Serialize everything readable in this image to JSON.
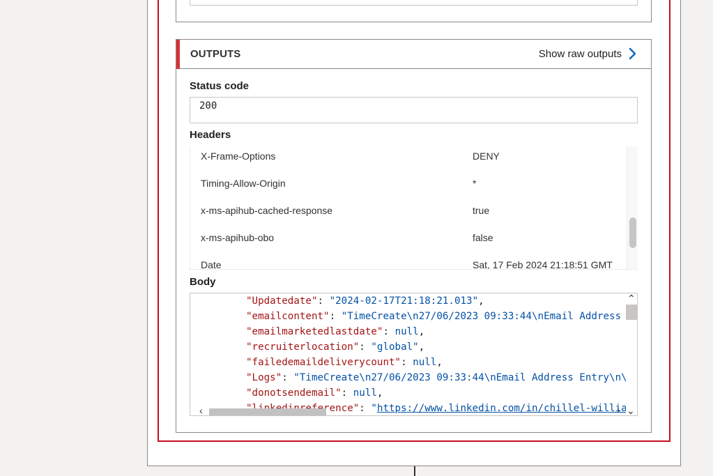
{
  "outputs": {
    "title": "OUTPUTS",
    "show_raw_label": "Show raw outputs",
    "accent_color": "#d13438",
    "chevron_icon": "chevron-right-icon"
  },
  "status": {
    "label": "Status code",
    "value": "200"
  },
  "headers": {
    "label": "Headers",
    "rows": [
      {
        "name": "X-Frame-Options",
        "value": "DENY"
      },
      {
        "name": "Timing-Allow-Origin",
        "value": "*"
      },
      {
        "name": "x-ms-apihub-cached-response",
        "value": "true"
      },
      {
        "name": "x-ms-apihub-obo",
        "value": "false"
      },
      {
        "name": "Date",
        "value": "Sat, 17 Feb 2024 21:18:51 GMT"
      }
    ]
  },
  "body": {
    "label": "Body",
    "lines": [
      {
        "key": "\"Updatedate\"",
        "sep": ": ",
        "val": "\"2024-02-17T21:18:21.013\"",
        "end": ",",
        "type": "s"
      },
      {
        "key": "\"emailcontent\"",
        "sep": ": ",
        "val": "\"TimeCreate\\n27/06/2023 09:33:44\\nEmail Address",
        "end": "",
        "type": "s"
      },
      {
        "key": "\"emailmarketedlastdate\"",
        "sep": ": ",
        "val": "null",
        "end": ",",
        "type": "n"
      },
      {
        "key": "\"recruiterlocation\"",
        "sep": ": ",
        "val": "\"global\"",
        "end": ",",
        "type": "s"
      },
      {
        "key": "\"failedemaildeliverycount\"",
        "sep": ": ",
        "val": "null",
        "end": ",",
        "type": "n"
      },
      {
        "key": "\"Logs\"",
        "sep": ": ",
        "val": "\"TimeCreate\\n27/06/2023 09:33:44\\nEmail Address Entry\\n\\",
        "end": "",
        "type": "s"
      },
      {
        "key": "\"donotsendemail\"",
        "sep": ": ",
        "val": "null",
        "end": ",",
        "type": "n"
      },
      {
        "key": "\"linkedinreference\"",
        "sep": ": ",
        "val": "\"",
        "url": "https://www.linkedin.com/in/chillel-willia",
        "end": "",
        "type": "s"
      }
    ]
  }
}
